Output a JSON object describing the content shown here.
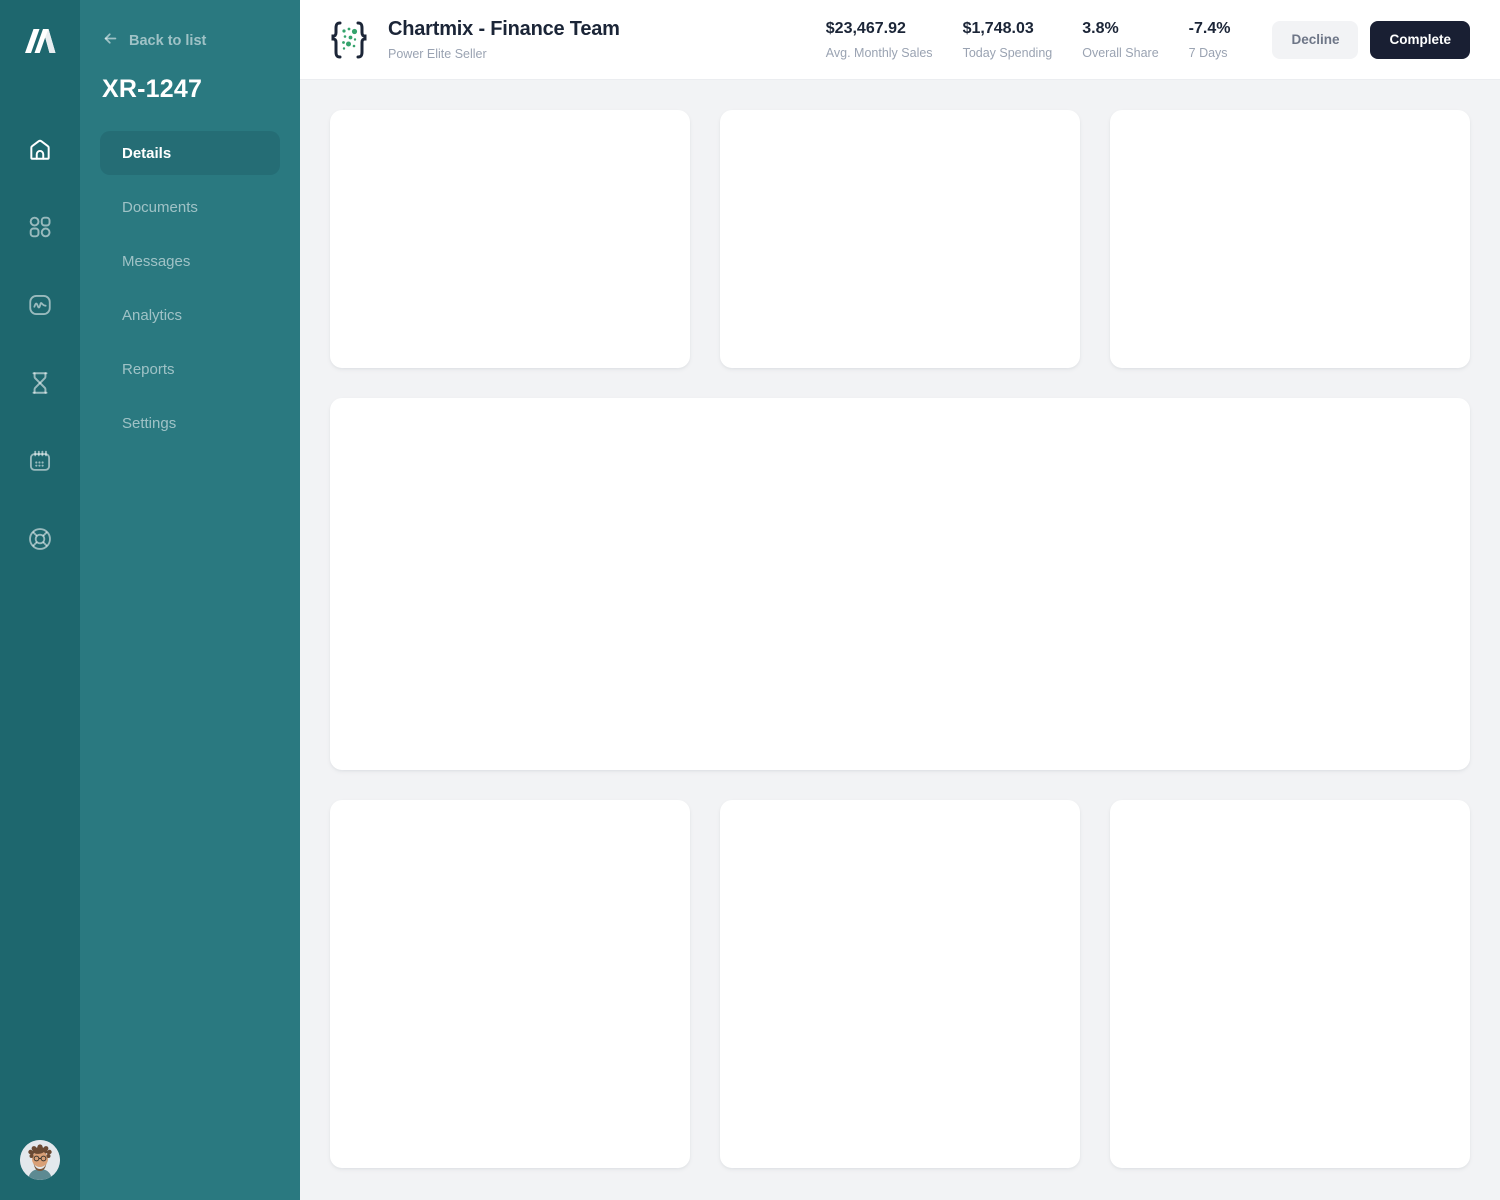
{
  "rail": {
    "icons": [
      {
        "name": "home-icon",
        "active": true
      },
      {
        "name": "grid-icon",
        "active": false
      },
      {
        "name": "activity-icon",
        "active": false
      },
      {
        "name": "hourglass-icon",
        "active": false
      },
      {
        "name": "calendar-icon",
        "active": false
      },
      {
        "name": "lifebuoy-icon",
        "active": false
      }
    ],
    "avatar": "user-avatar"
  },
  "panel": {
    "back_label": "Back to list",
    "record_id": "XR-1247",
    "nav_items": [
      {
        "label": "Details",
        "active": true
      },
      {
        "label": "Documents",
        "active": false
      },
      {
        "label": "Messages",
        "active": false
      },
      {
        "label": "Analytics",
        "active": false
      },
      {
        "label": "Reports",
        "active": false
      },
      {
        "label": "Settings",
        "active": false
      }
    ]
  },
  "header": {
    "title": "Chartmix - Finance Team",
    "subtitle": "Power Elite Seller",
    "stats": [
      {
        "value": "$23,467.92",
        "label": "Avg. Monthly Sales"
      },
      {
        "value": "$1,748.03",
        "label": "Today Spending"
      },
      {
        "value": "3.8%",
        "label": "Overall Share"
      },
      {
        "value": "-7.4%",
        "label": "7 Days"
      }
    ],
    "decline_label": "Decline",
    "complete_label": "Complete"
  },
  "colors": {
    "rail_bg": "#1e676e",
    "panel_bg": "#2a7980",
    "active_item_bg": "#256d75",
    "content_bg": "#f2f3f5",
    "dark_button": "#191f33",
    "accent_green": "#34a36c",
    "text_dark": "#1b2537",
    "text_muted": "#9aa3b2"
  }
}
